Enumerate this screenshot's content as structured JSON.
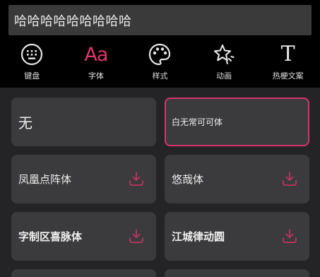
{
  "input": {
    "value": "哈哈哈哈哈哈哈哈哈"
  },
  "tabs": [
    {
      "id": "keyboard",
      "label": "键盘",
      "icon": "keyboard-icon"
    },
    {
      "id": "font",
      "label": "字体",
      "icon": "aa-font-icon",
      "glyph": "Aa",
      "active": true
    },
    {
      "id": "style",
      "label": "样式",
      "icon": "palette-icon"
    },
    {
      "id": "animation",
      "label": "动画",
      "icon": "sparkle-star-icon"
    },
    {
      "id": "hot-text",
      "label": "热梗文案",
      "icon": "text-t-icon",
      "glyph": "T"
    }
  ],
  "fonts": [
    {
      "name": "无",
      "download": false,
      "selected": false
    },
    {
      "name": "白无常可可体",
      "download": false,
      "selected": true
    },
    {
      "name": "凤凰点阵体",
      "download": true
    },
    {
      "name": "悠哉体",
      "download": true
    },
    {
      "name": "字制区喜脉体",
      "download": true
    },
    {
      "name": "江城律动圆",
      "download": true
    }
  ],
  "colors": {
    "accent": "#e0356e",
    "download_icon": "#c2335f",
    "card_bg": "#3b3b3d",
    "panel_bg": "#242426",
    "input_bg": "#3a3a3a"
  }
}
